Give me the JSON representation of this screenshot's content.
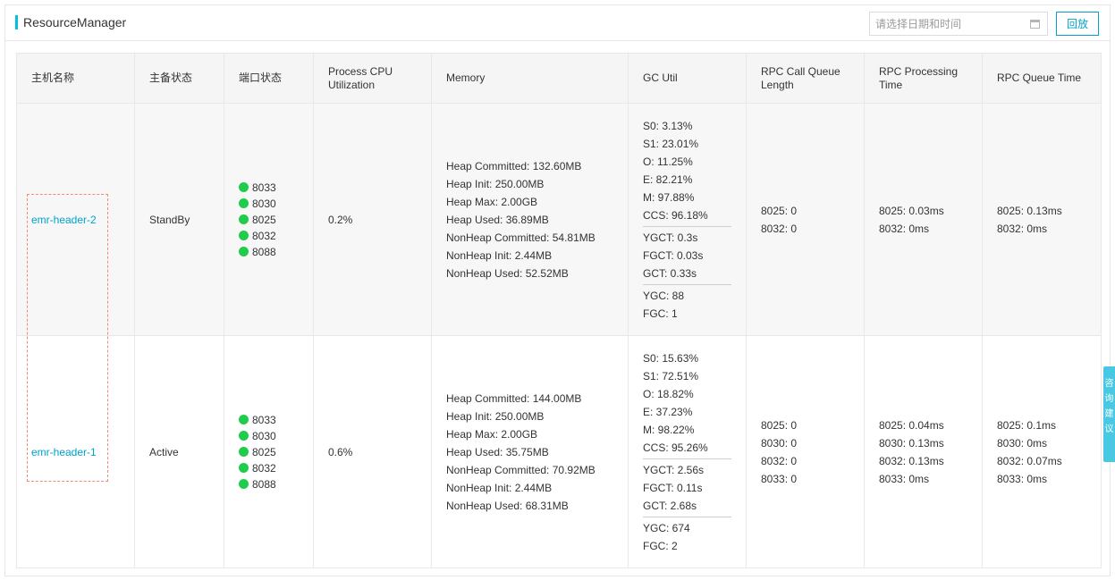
{
  "header": {
    "title": "ResourceManager",
    "date_placeholder": "请选择日期和时间",
    "replay_label": "回放"
  },
  "table": {
    "columns": [
      "主机名称",
      "主备状态",
      "端口状态",
      "Process CPU Utilization",
      "Memory",
      "GC Util",
      "RPC Call Queue Length",
      "RPC Processing Time",
      "RPC Queue Time"
    ],
    "rows": [
      {
        "host": "emr-header-2",
        "state": "StandBy",
        "ports": [
          "8033",
          "8030",
          "8025",
          "8032",
          "8088"
        ],
        "cpu": "0.2%",
        "memory": [
          "Heap Committed: 132.60MB",
          "Heap Init: 250.00MB",
          "Heap Max: 2.00GB",
          "Heap Used: 36.89MB",
          "NonHeap Committed: 54.81MB",
          "NonHeap Init: 2.44MB",
          "NonHeap Used: 52.52MB"
        ],
        "gc_util": [
          "S0: 3.13%",
          "S1: 23.01%",
          "O: 11.25%",
          "E: 82.21%",
          "M: 97.88%",
          "CCS: 96.18%"
        ],
        "gc_time": [
          "YGCT: 0.3s",
          "FGCT: 0.03s",
          "GCT: 0.33s"
        ],
        "gc_count": [
          "YGC: 88",
          "FGC: 1"
        ],
        "rpc_call_queue": [
          "8025: 0",
          "8032: 0"
        ],
        "rpc_processing": [
          "8025: 0.03ms",
          "8032: 0ms"
        ],
        "rpc_queue_time": [
          "8025: 0.13ms",
          "8032: 0ms"
        ]
      },
      {
        "host": "emr-header-1",
        "state": "Active",
        "ports": [
          "8033",
          "8030",
          "8025",
          "8032",
          "8088"
        ],
        "cpu": "0.6%",
        "memory": [
          "Heap Committed: 144.00MB",
          "Heap Init: 250.00MB",
          "Heap Max: 2.00GB",
          "Heap Used: 35.75MB",
          "NonHeap Committed: 70.92MB",
          "NonHeap Init: 2.44MB",
          "NonHeap Used: 68.31MB"
        ],
        "gc_util": [
          "S0: 15.63%",
          "S1: 72.51%",
          "O: 18.82%",
          "E: 37.23%",
          "M: 98.22%",
          "CCS: 95.26%"
        ],
        "gc_time": [
          "YGCT: 2.56s",
          "FGCT: 0.11s",
          "GCT: 2.68s"
        ],
        "gc_count": [
          "YGC: 674",
          "FGC: 2"
        ],
        "rpc_call_queue": [
          "8025: 0",
          "8030: 0",
          "8032: 0",
          "8033: 0"
        ],
        "rpc_processing": [
          "8025: 0.04ms",
          "8030: 0.13ms",
          "8032: 0.13ms",
          "8033: 0ms"
        ],
        "rpc_queue_time": [
          "8025: 0.1ms",
          "8030: 0ms",
          "8032: 0.07ms",
          "8033: 0ms"
        ]
      }
    ]
  },
  "feedback_tab": [
    "咨",
    "询",
    "建",
    "议"
  ],
  "colors": {
    "accent": "#00c1de",
    "link": "#00a2ca",
    "status_ok": "#1fcc4c",
    "highlight_box": "#f28b74"
  },
  "icons": {
    "calendar": "calendar-icon",
    "port_status": "status-dot-icon",
    "feedback": "feedback-icon"
  }
}
